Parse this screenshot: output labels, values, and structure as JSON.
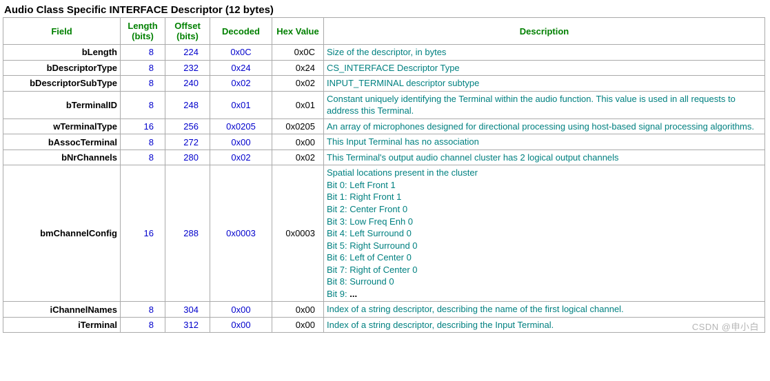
{
  "title": "Audio Class Specific INTERFACE Descriptor (12 bytes)",
  "headers": {
    "field": "Field",
    "length": "Length (bits)",
    "offset": "Offset (bits)",
    "decoded": "Decoded",
    "hexvalue": "Hex Value",
    "description": "Description"
  },
  "rows": [
    {
      "field": "bLength",
      "length": "8",
      "offset": "224",
      "decoded": "0x0C",
      "hex": "0x0C",
      "desc_lines": [
        "Size of the descriptor, in bytes"
      ]
    },
    {
      "field": "bDescriptorType",
      "length": "8",
      "offset": "232",
      "decoded": "0x24",
      "hex": "0x24",
      "desc_lines": [
        "CS_INTERFACE Descriptor Type"
      ]
    },
    {
      "field": "bDescriptorSubType",
      "length": "8",
      "offset": "240",
      "decoded": "0x02",
      "hex": "0x02",
      "desc_lines": [
        "INPUT_TERMINAL descriptor subtype"
      ]
    },
    {
      "field": "bTerminalID",
      "length": "8",
      "offset": "248",
      "decoded": "0x01",
      "hex": "0x01",
      "desc_lines": [
        " Constant uniquely identifying the Terminal within the audio function. This value is used in all requests to address this Terminal."
      ]
    },
    {
      "field": "wTerminalType",
      "length": "16",
      "offset": "256",
      "decoded": "0x0205",
      "hex": "0x0205",
      "desc_lines": [
        " An array of microphones designed for directional processing using host-based signal processing algorithms."
      ]
    },
    {
      "field": "bAssocTerminal",
      "length": "8",
      "offset": "272",
      "decoded": "0x00",
      "hex": "0x00",
      "desc_lines": [
        " This Input Terminal has no association"
      ]
    },
    {
      "field": "bNrChannels",
      "length": "8",
      "offset": "280",
      "decoded": "0x02",
      "hex": "0x02",
      "desc_lines": [
        " This Terminal's output audio channel cluster has 2 logical output channels"
      ]
    },
    {
      "field": "bmChannelConfig",
      "length": "16",
      "offset": "288",
      "decoded": "0x0003",
      "hex": "0x0003",
      "desc_lines": [
        " Spatial locations present in the cluster",
        "Bit 0: Left Front 1",
        "Bit 1: Right Front 1",
        "Bit 2: Center Front 0",
        "Bit 3: Low Freq Enh 0",
        "Bit 4: Left Surround 0",
        "Bit 5: Right Surround 0",
        "Bit 6: Left of Center 0",
        "Bit 7: Right of Center 0",
        "Bit 8: Surround 0",
        "Bit 9: ..."
      ]
    },
    {
      "field": "iChannelNames",
      "length": "8",
      "offset": "304",
      "decoded": "0x00",
      "hex": "0x00",
      "desc_lines": [
        " Index of a string descriptor, describing the name of the first logical channel."
      ]
    },
    {
      "field": "iTerminal",
      "length": "8",
      "offset": "312",
      "decoded": "0x00",
      "hex": "0x00",
      "desc_lines": [
        " Index of a string descriptor, describing the Input Terminal."
      ]
    }
  ],
  "watermark": "CSDN @申小白"
}
